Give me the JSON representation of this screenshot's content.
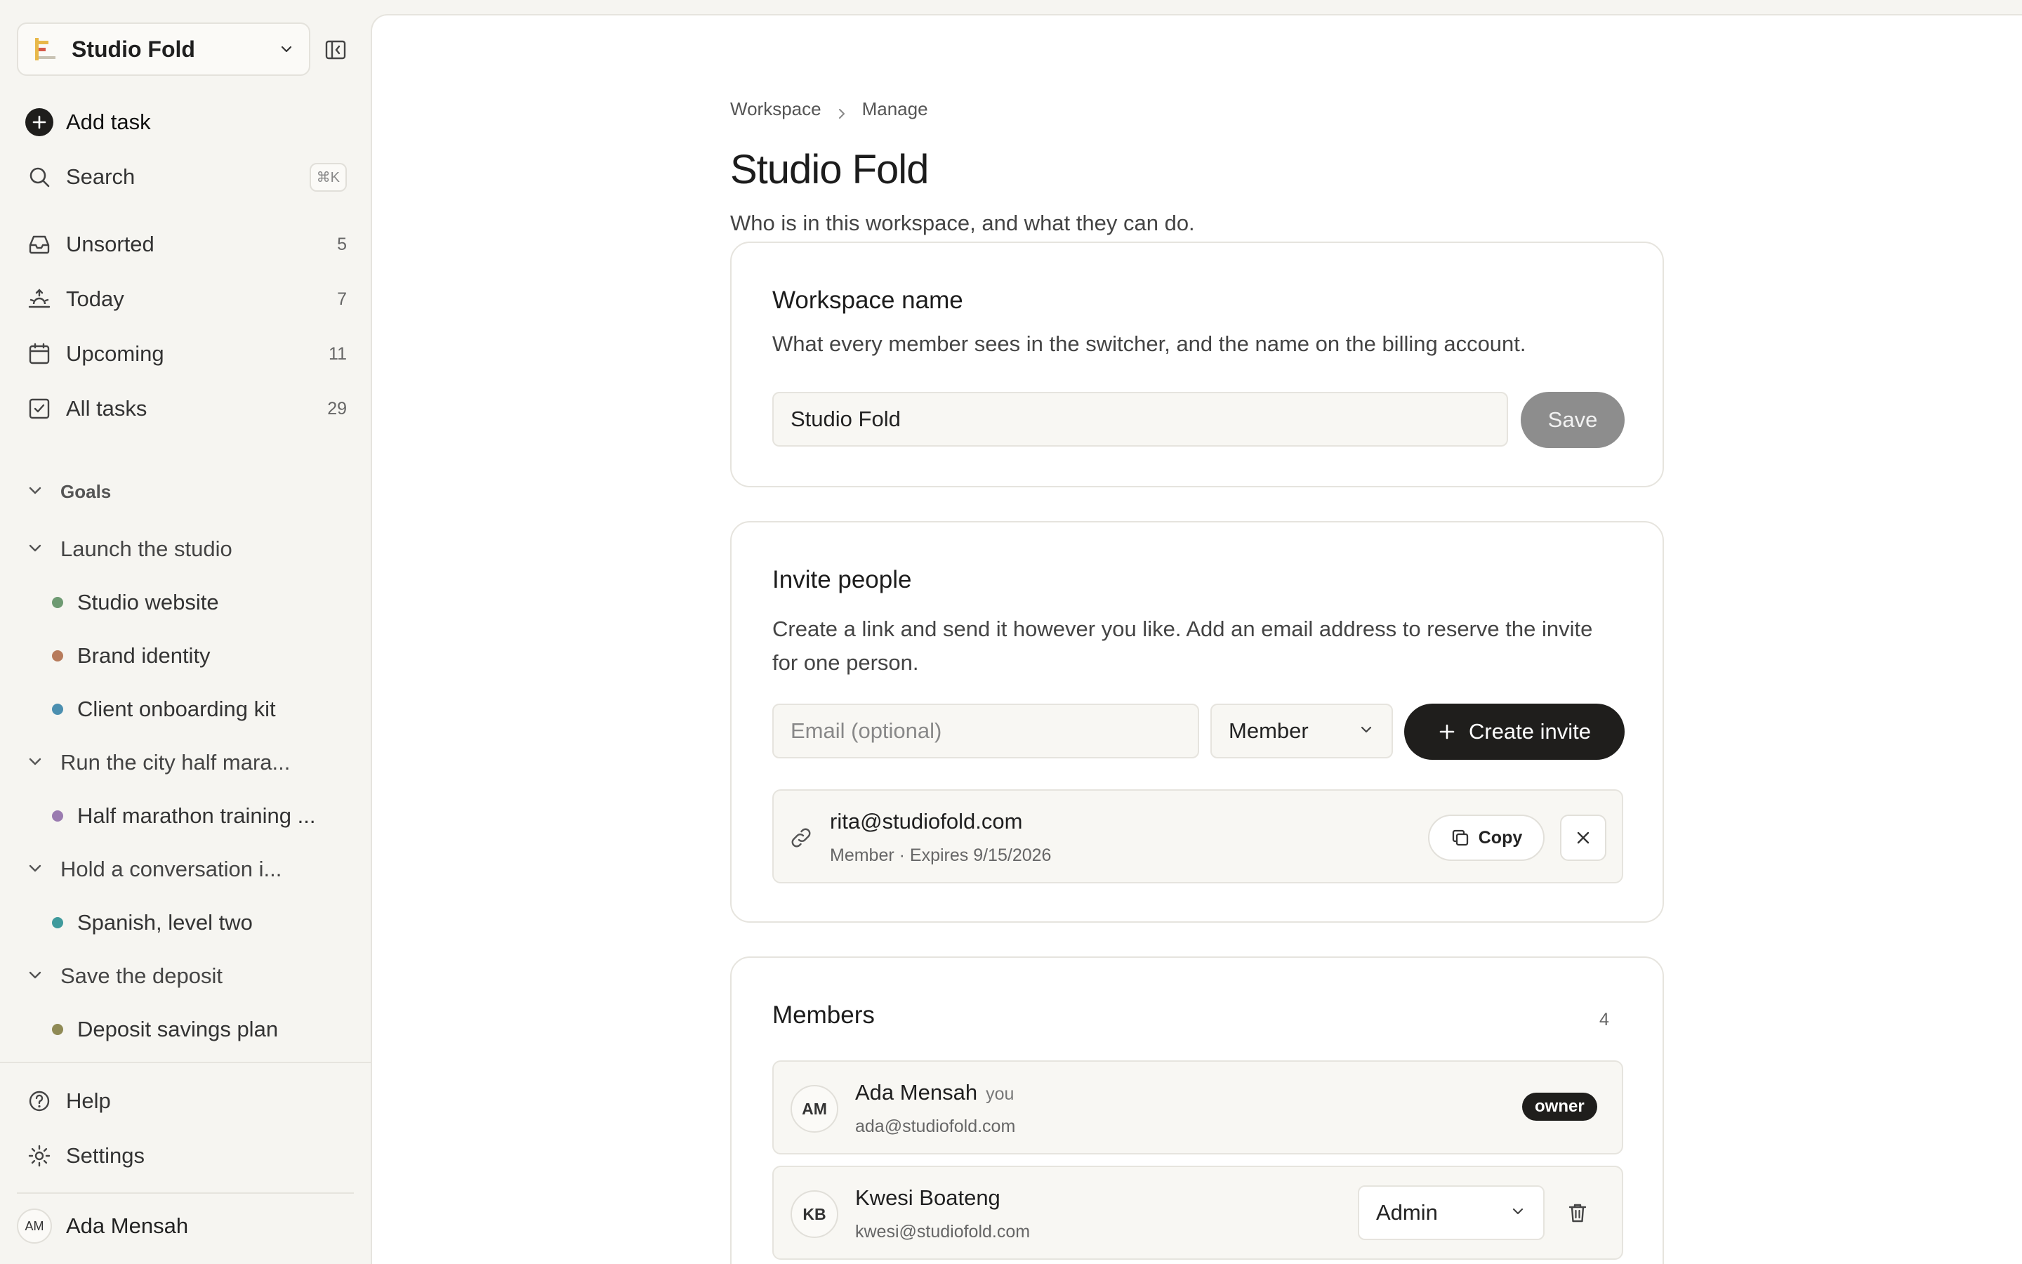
{
  "sidebar": {
    "workspace_name": "Studio Fold",
    "add_task": "Add task",
    "search": "Search",
    "search_shortcut": "⌘K",
    "nav": [
      {
        "label": "Unsorted",
        "count": "5"
      },
      {
        "label": "Today",
        "count": "7"
      },
      {
        "label": "Upcoming",
        "count": "11"
      },
      {
        "label": "All tasks",
        "count": "29"
      }
    ],
    "goals_header": "Goals",
    "goals": [
      {
        "label": "Launch the studio",
        "projects": [
          {
            "label": "Studio website",
            "color": "#6e9a72"
          },
          {
            "label": "Brand identity",
            "color": "#b77b5c"
          },
          {
            "label": "Client onboarding kit",
            "color": "#4b8fb0"
          }
        ]
      },
      {
        "label": "Run the city half mara...",
        "projects": [
          {
            "label": "Half marathon training ...",
            "color": "#9a7bb0"
          }
        ]
      },
      {
        "label": "Hold a conversation i...",
        "projects": [
          {
            "label": "Spanish, level two",
            "color": "#3f9a9c"
          }
        ]
      },
      {
        "label": "Save the deposit",
        "projects": [
          {
            "label": "Deposit savings plan",
            "color": "#8f8a55"
          }
        ]
      }
    ],
    "help": "Help",
    "settings": "Settings",
    "user_initials": "AM",
    "user_name": "Ada Mensah"
  },
  "main": {
    "breadcrumb": [
      "Workspace",
      "Manage"
    ],
    "title": "Studio Fold",
    "subtitle": "Who is in this workspace, and what they can do.",
    "workspace_card": {
      "title": "Workspace name",
      "description": "What every member sees in the switcher, and the name on the billing account.",
      "input_value": "Studio Fold",
      "save_label": "Save"
    },
    "invite_card": {
      "title": "Invite people",
      "description": "Create a link and send it however you like. Add an email address to reserve the invite for one person.",
      "email_placeholder": "Email (optional)",
      "role_selected": "Member",
      "create_label": "Create invite",
      "invite": {
        "email": "rita@studiofold.com",
        "meta": "Member · Expires 9/15/2026",
        "copy_label": "Copy"
      }
    },
    "members_card": {
      "title": "Members",
      "count": "4",
      "members": [
        {
          "initials": "AM",
          "name": "Ada Mensah",
          "you": "you",
          "email": "ada@studiofold.com",
          "role": "owner"
        },
        {
          "initials": "KB",
          "name": "Kwesi Boateng",
          "email": "kwesi@studiofold.com",
          "role": "Admin"
        }
      ]
    }
  },
  "colors": {
    "accent_dark": "#1f1e1c",
    "save_disabled": "#8d8d8d",
    "background": "#f6f5f1"
  }
}
